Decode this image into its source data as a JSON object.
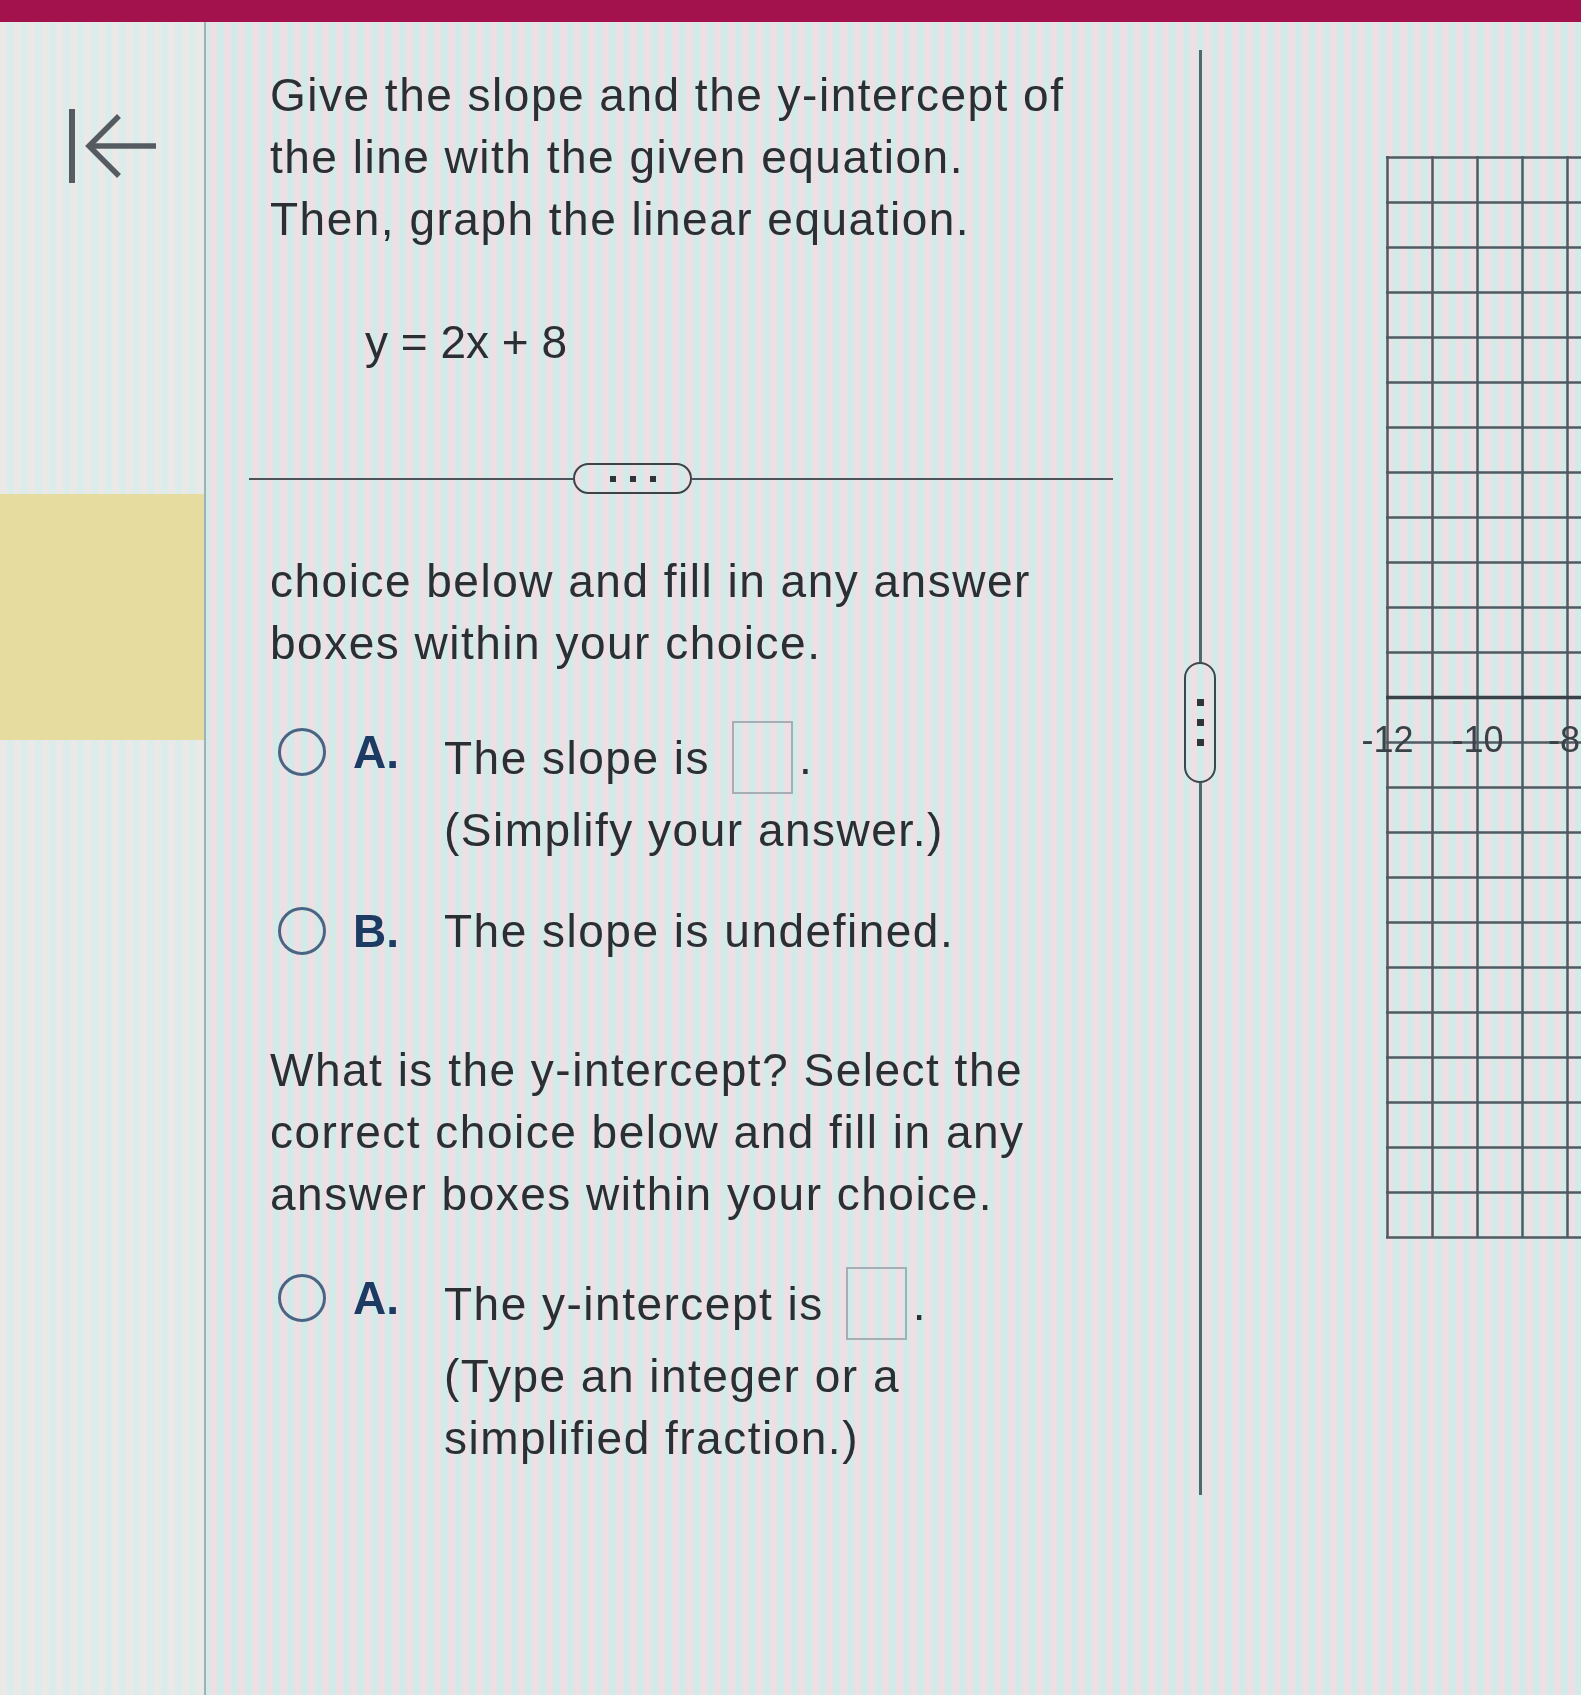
{
  "question": {
    "paragraphs": [
      "Give the slope and the y-intercept of the line with the given equation.",
      "Then, graph the linear equation."
    ],
    "equation": "y = 2x + 8"
  },
  "answer": {
    "prompt_tail": "choice below and fill in any answer boxes within your choice.",
    "slope_choices": [
      {
        "letter": "A.",
        "kind": "input",
        "text": "The slope is",
        "after": ".",
        "hint": "(Simplify your answer.)",
        "selected": false
      },
      {
        "letter": "B.",
        "kind": "text",
        "text": "The slope is undefined.",
        "selected": false
      }
    ],
    "intercept_prompt": "What is the y-intercept? Select the correct choice below and fill in any answer boxes within your choice.",
    "intercept_choices": [
      {
        "letter": "A.",
        "kind": "input",
        "text": "The y-intercept is",
        "after": ".",
        "hint": "(Type an integer or a simplified fraction.)",
        "selected": false
      }
    ]
  },
  "graph": {
    "x_tick_labels": [
      "-12",
      "-10",
      "-8"
    ]
  }
}
